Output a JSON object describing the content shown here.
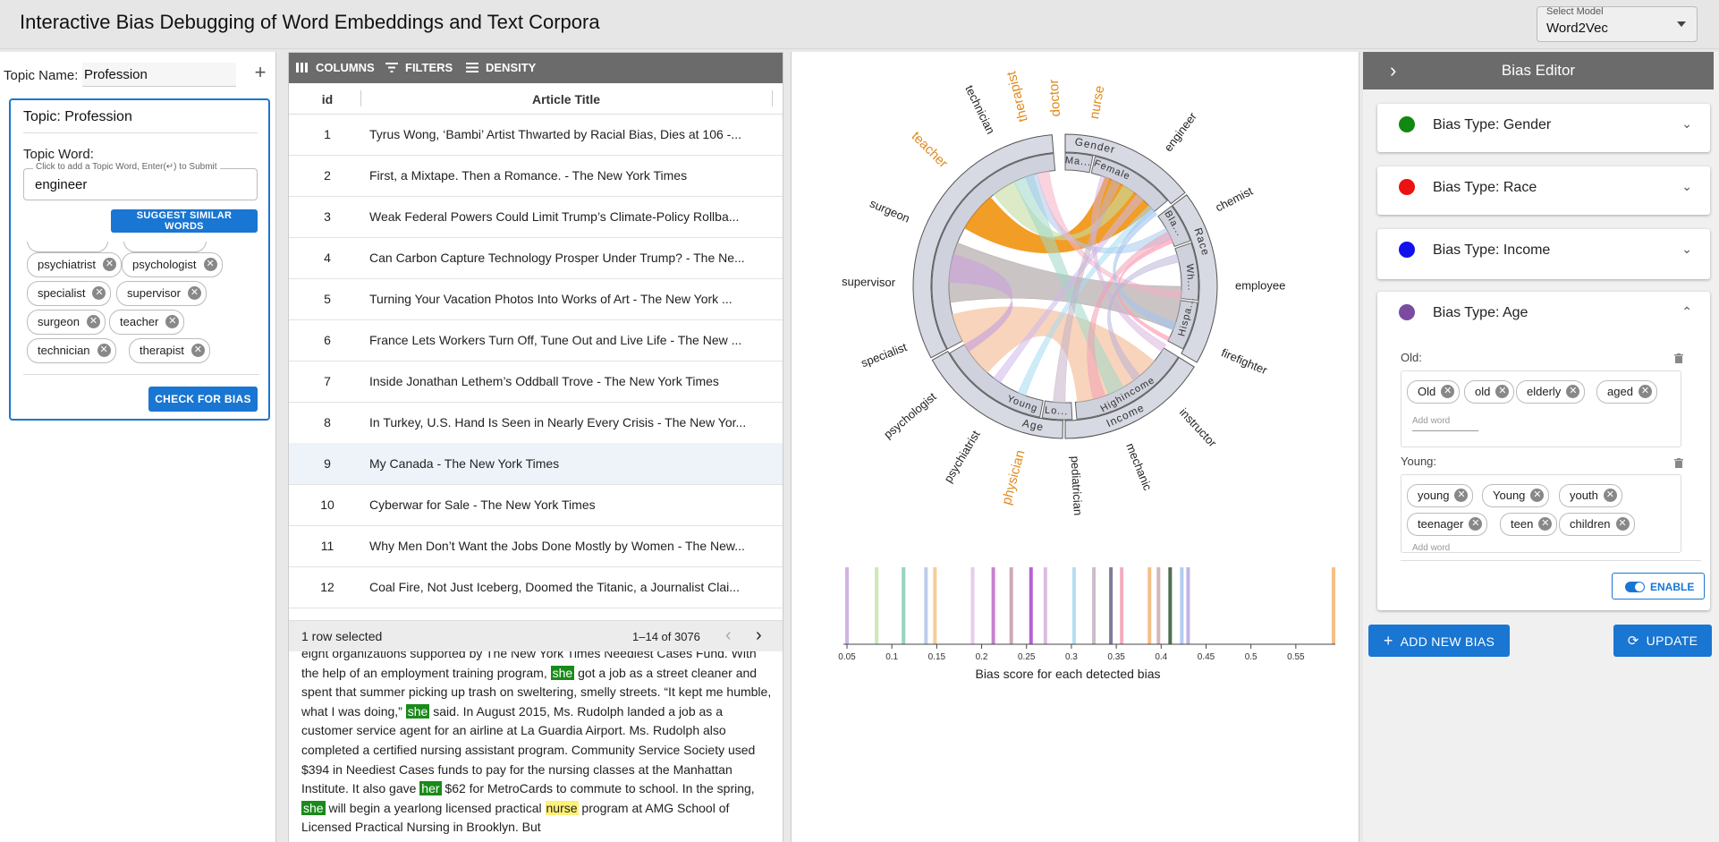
{
  "app": {
    "title": "Interactive Bias Debugging of Word Embeddings and Text Corpora"
  },
  "model_select": {
    "label": "Select Model",
    "value": "Word2Vec"
  },
  "topic_panel": {
    "topic_name_label": "Topic Name:",
    "topic_name_value": "Profession",
    "add_icon": "plus-icon",
    "card_title": "Topic: Profession",
    "topic_word_label": "Topic Word:",
    "topic_word_hint": "Click to add a Topic Word, Enter(↵) to Submit",
    "topic_word_value": "engineer",
    "suggest_button": "SUGGEST SIMILAR WORDS",
    "check_button": "CHECK FOR BIAS",
    "chips": [
      "psychiatrist",
      "psychologist",
      "specialist",
      "supervisor",
      "surgeon",
      "teacher",
      "technician",
      "therapist"
    ]
  },
  "table": {
    "toolbar": {
      "columns": "COLUMNS",
      "filters": "FILTERS",
      "density": "DENSITY"
    },
    "columns": {
      "id": "id",
      "title": "Article Title"
    },
    "rows": [
      {
        "id": "1",
        "title": "Tyrus Wong, ‘Bambi’ Artist Thwarted by Racial Bias, Dies at 106 -..."
      },
      {
        "id": "2",
        "title": "First, a Mixtape. Then a Romance. - The New York Times"
      },
      {
        "id": "3",
        "title": "Weak Federal Powers Could Limit Trump’s Climate-Policy Rollba..."
      },
      {
        "id": "4",
        "title": "Can Carbon Capture Technology Prosper Under Trump? - The Ne..."
      },
      {
        "id": "5",
        "title": "Turning Your Vacation Photos Into Works of Art - The New York ..."
      },
      {
        "id": "6",
        "title": "France Lets Workers Turn Off, Tune Out and Live Life - The New ..."
      },
      {
        "id": "7",
        "title": "Inside Jonathan Lethem’s Oddball Trove - The New York Times"
      },
      {
        "id": "8",
        "title": "In Turkey, U.S. Hand Is Seen in Nearly Every Crisis - The New Yor..."
      },
      {
        "id": "9",
        "title": "My Canada - The New York Times"
      },
      {
        "id": "10",
        "title": "Cyberwar for Sale - The New York Times"
      },
      {
        "id": "11",
        "title": "Why Men Don’t Want the Jobs Done Mostly by Women - The New..."
      },
      {
        "id": "12",
        "title": "Coal Fire, Not Just Iceberg, Doomed the Titanic, a Journalist Clai..."
      }
    ],
    "selected_row": "9",
    "footer": {
      "selected": "1 row selected",
      "range": "1–14 of 3076"
    }
  },
  "article": {
    "segments": [
      {
        "t": "eight organizations supported by The New York Times Neediest Cases Fund. With the help of an employment training program, ",
        "h": ""
      },
      {
        "t": "she",
        "h": "g"
      },
      {
        "t": " got a job as a street cleaner and spent that summer picking up trash on sweltering, smelly streets. “It kept me humble, what I was doing,” ",
        "h": ""
      },
      {
        "t": "she",
        "h": "g"
      },
      {
        "t": " said. In August 2015, Ms. Rudolph landed a job as a customer service agent for an airline at La Guardia Airport. Ms. Rudolph also completed a certified nursing assistant program. Community Service Society used $394 in Neediest Cases funds to pay for the nursing classes at the Manhattan Institute. It also gave ",
        "h": ""
      },
      {
        "t": "her",
        "h": "g"
      },
      {
        "t": " $62 for MetroCards to commute to school. In the spring, ",
        "h": ""
      },
      {
        "t": "she",
        "h": "g"
      },
      {
        "t": " will begin a yearlong licensed practical ",
        "h": ""
      },
      {
        "t": "nurse",
        "h": "y"
      },
      {
        "t": " program at AMG School of Licensed Practical Nursing in Brooklyn. But",
        "h": ""
      }
    ]
  },
  "chord": {
    "words": [
      {
        "label": "therapist",
        "angle": -14,
        "color": "#e08a1e"
      },
      {
        "label": "doctor",
        "angle": -3,
        "color": "#e08a1e"
      },
      {
        "label": "nurse",
        "angle": 10,
        "color": "#e08a1e"
      },
      {
        "label": "engineer",
        "angle": 37,
        "color": "#222222"
      },
      {
        "label": "chemist",
        "angle": 63,
        "color": "#222222"
      },
      {
        "label": "employee",
        "angle": 90,
        "color": "#222222"
      },
      {
        "label": "firefighter",
        "angle": 113,
        "color": "#222222"
      },
      {
        "label": "instructor",
        "angle": 137,
        "color": "#222222"
      },
      {
        "label": "mechanic",
        "angle": 158,
        "color": "#222222"
      },
      {
        "label": "pediatrician",
        "angle": 177,
        "color": "#222222"
      },
      {
        "label": "physician",
        "angle": 195,
        "color": "#e08a1e"
      },
      {
        "label": "psychiatrist",
        "angle": 211,
        "color": "#222222"
      },
      {
        "label": "psychologist",
        "angle": 230,
        "color": "#222222"
      },
      {
        "label": "specialist",
        "angle": 249,
        "color": "#222222"
      },
      {
        "label": "supervisor",
        "angle": 271,
        "color": "#222222"
      },
      {
        "label": "surgeon",
        "angle": 293,
        "color": "#222222"
      },
      {
        "label": "teacher",
        "angle": 315,
        "color": "#e08a1e"
      },
      {
        "label": "technician",
        "angle": 334,
        "color": "#222222"
      }
    ],
    "groups": [
      {
        "label": "Gender",
        "angle": 12
      },
      {
        "label": "Race",
        "angle": 72
      },
      {
        "label": "Income",
        "angle": 155
      },
      {
        "label": "Age",
        "angle": 193
      }
    ],
    "subgroups": [
      {
        "label": "Ma...",
        "angle": 6
      },
      {
        "label": "Female",
        "angle": 22
      },
      {
        "label": "Bla...",
        "angle": 60
      },
      {
        "label": "Wh...",
        "angle": 86
      },
      {
        "label": "Hispa...",
        "angle": 104
      },
      {
        "label": "Highincome",
        "angle": 150
      },
      {
        "label": "Lo...",
        "angle": 184
      },
      {
        "label": "Young",
        "angle": 200
      }
    ]
  },
  "score_chart": {
    "type": "bar",
    "title": "",
    "xlabel": "Bias score for each detected bias",
    "xticks": [
      "0.05",
      "0.1",
      "0.15",
      "0.2",
      "0.25",
      "0.3",
      "0.35",
      "0.4",
      "0.45",
      "0.5",
      "0.55"
    ],
    "xlim": [
      0.05,
      0.59
    ],
    "scores": [
      {
        "x": 0.05,
        "color": "#c8a6e0"
      },
      {
        "x": 0.083,
        "color": "#c4e6a6"
      },
      {
        "x": 0.113,
        "color": "#84ccb4"
      },
      {
        "x": 0.138,
        "color": "#b4c4e6"
      },
      {
        "x": 0.148,
        "color": "#f4c486"
      },
      {
        "x": 0.19,
        "color": "#e0c4e8"
      },
      {
        "x": 0.213,
        "color": "#c06ac8"
      },
      {
        "x": 0.233,
        "color": "#c89aa8"
      },
      {
        "x": 0.255,
        "color": "#aa44cc"
      },
      {
        "x": 0.271,
        "color": "#d6b0dc"
      },
      {
        "x": 0.303,
        "color": "#a6d8f0"
      },
      {
        "x": 0.325,
        "color": "#c4b0c4"
      },
      {
        "x": 0.344,
        "color": "#666688"
      },
      {
        "x": 0.356,
        "color": "#f0a0b4"
      },
      {
        "x": 0.387,
        "color": "#f4b470"
      },
      {
        "x": 0.397,
        "color": "#ccaaaa"
      },
      {
        "x": 0.41,
        "color": "#335533"
      },
      {
        "x": 0.423,
        "color": "#a4c4f0"
      },
      {
        "x": 0.43,
        "color": "#b8a4e0"
      },
      {
        "x": 0.592,
        "color": "#f4b470"
      }
    ]
  },
  "bias_editor": {
    "title": "Bias Editor",
    "types": [
      {
        "label": "Bias Type: Gender",
        "color": "#118811"
      },
      {
        "label": "Bias Type: Race",
        "color": "#ee1111"
      },
      {
        "label": "Bias Type: Income",
        "color": "#1111ee"
      },
      {
        "label": "Bias Type: Age",
        "color": "#7b4ba0"
      }
    ],
    "old_label": "Old:",
    "old_words": [
      "Old",
      "old",
      "elderly",
      "aged"
    ],
    "young_label": "Young:",
    "young_words": [
      "young",
      "Young",
      "youth",
      "teenager",
      "teen",
      "children"
    ],
    "add_word": "Add word",
    "enable": "ENABLE",
    "add_new_bias": "ADD NEW BIAS",
    "update": "UPDATE"
  }
}
